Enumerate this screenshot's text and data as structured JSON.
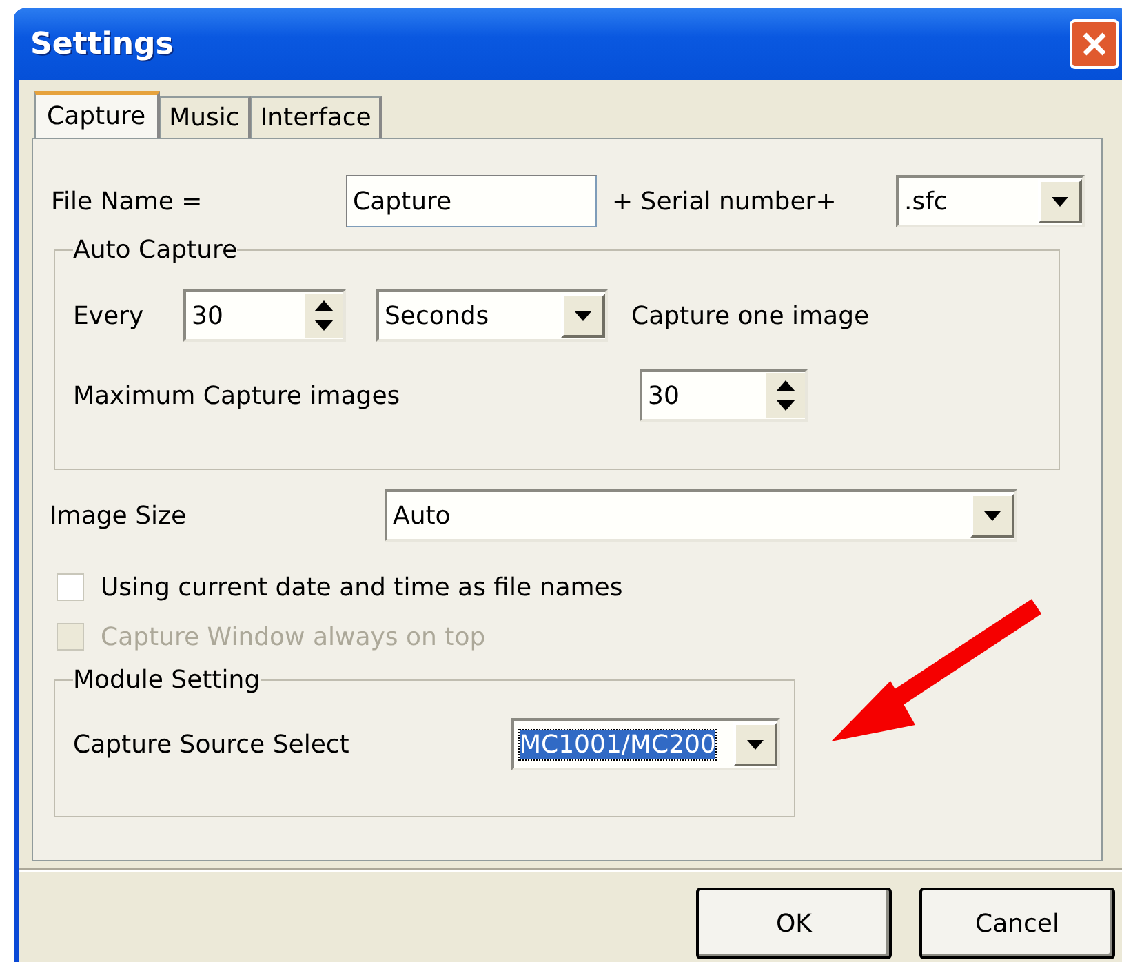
{
  "window": {
    "title": "Settings"
  },
  "tabs": [
    {
      "label": "Capture",
      "selected": true
    },
    {
      "label": "Music",
      "selected": false
    },
    {
      "label": "Interface",
      "selected": false
    }
  ],
  "file_name": {
    "label": "File Name =",
    "value": "Capture",
    "suffix_label": "+ Serial number+",
    "extension": ".sfc"
  },
  "auto_capture": {
    "title": "Auto Capture",
    "every_label": "Every",
    "every_value": "30",
    "unit": "Seconds",
    "unit_note": "Capture one image",
    "max_label": "Maximum Capture images",
    "max_value": "30"
  },
  "image_size": {
    "label": "Image Size",
    "value": "Auto"
  },
  "checkboxes": [
    {
      "label": "Using current date and time as file names",
      "checked": false,
      "disabled": false
    },
    {
      "label": "Capture Window always on top",
      "checked": false,
      "disabled": true
    }
  ],
  "module_setting": {
    "title": "Module Setting",
    "label": "Capture Source Select",
    "value": "MC1001/MC200",
    "selected": true
  },
  "buttons": [
    {
      "label": "OK"
    },
    {
      "label": "Cancel"
    }
  ]
}
